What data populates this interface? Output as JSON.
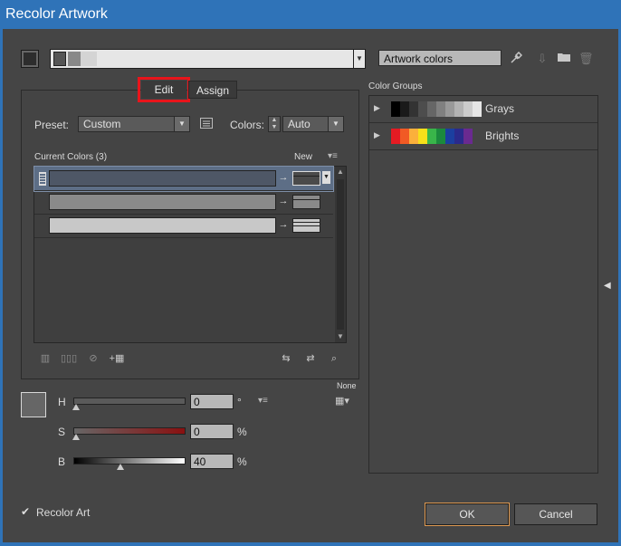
{
  "window": {
    "title": "Recolor Artwork"
  },
  "top": {
    "harmony_colors": [
      "#555555",
      "#888888",
      "#d4d4d4",
      "#e6e6e6"
    ],
    "name_field": "Artwork colors"
  },
  "tabs": {
    "edit": "Edit",
    "assign": "Assign"
  },
  "preset": {
    "label": "Preset:",
    "value": "Custom"
  },
  "colors": {
    "label": "Colors:",
    "value": "Auto"
  },
  "current_colors": {
    "header": "Current Colors (3)",
    "new_header": "New",
    "rows": [
      {
        "color": "#4e5766",
        "new_color": "#4a4a4a",
        "selected": true
      },
      {
        "color": "#8a8a8a",
        "new_color": "#8a8a8a",
        "selected": false
      },
      {
        "color": "#c8c8c8",
        "new_color": "#c8c8c8",
        "selected": false
      }
    ]
  },
  "sliders": {
    "none_label": "None",
    "h": {
      "label": "H",
      "value": "0",
      "unit": "°",
      "level": 0.0
    },
    "s": {
      "label": "S",
      "value": "0",
      "unit": "%",
      "level": 0.0
    },
    "b": {
      "label": "B",
      "value": "40",
      "unit": "%",
      "level": 0.4
    },
    "swatch_color": "#666666"
  },
  "color_groups": {
    "header": "Color Groups",
    "groups": [
      {
        "name": "Grays",
        "colors": [
          "#000000",
          "#1a1a1a",
          "#333333",
          "#4d4d4d",
          "#666666",
          "#808080",
          "#999999",
          "#b3b3b3",
          "#cccccc",
          "#e6e6e6"
        ]
      },
      {
        "name": "Brights",
        "colors": [
          "#e51b23",
          "#f15a24",
          "#fbb03b",
          "#f7e01a",
          "#39b54a",
          "#1b8a3d",
          "#1b3fa0",
          "#2a2a8c",
          "#6a2a90"
        ]
      }
    ]
  },
  "recolor_art": {
    "label": "Recolor Art",
    "checked": "✔"
  },
  "buttons": {
    "ok": "OK",
    "cancel": "Cancel"
  }
}
